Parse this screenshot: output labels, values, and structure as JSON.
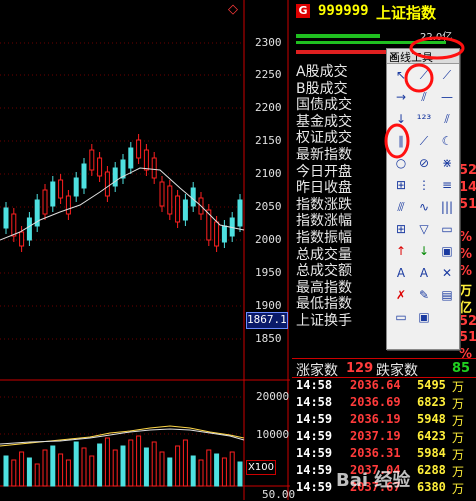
{
  "stock": {
    "badge": "G",
    "code": "999999",
    "name": "上证指数",
    "top_diamond": "◇",
    "volume_header": "22.0亿"
  },
  "price_axis": [
    "2300",
    "2250",
    "2200",
    "2150",
    "2100",
    "2050",
    "2000",
    "1950",
    "1900",
    "1850"
  ],
  "current_price": "1867.1",
  "volume_axis": [
    "20000",
    "10000"
  ],
  "volume_multiplier": "X100",
  "bottom_value": "50.00",
  "labels": [
    "A股成交",
    "B股成交",
    "国债成交",
    "基金成交",
    "权证成交",
    "最新指数",
    "今日开盘",
    "昨日收盘",
    "指数涨跌",
    "指数涨幅",
    "指数振幅",
    "总成交量",
    "总成交额",
    "最高指数",
    "最低指数",
    "上证换手"
  ],
  "right_edge_values": [
    "52",
    "14",
    "51",
    "%",
    "%",
    "%",
    "万",
    "亿",
    "52",
    "51",
    "%"
  ],
  "counts_row": {
    "label": "涨家数",
    "value": "129",
    "label2": "跌家数",
    "value2": "85"
  },
  "trades": [
    {
      "time": "14:58",
      "price": "2036.64",
      "volume": "5495",
      "unit": "万"
    },
    {
      "time": "14:58",
      "price": "2036.69",
      "volume": "6823",
      "unit": "万"
    },
    {
      "time": "14:59",
      "price": "2036.19",
      "volume": "5948",
      "unit": "万"
    },
    {
      "time": "14:59",
      "price": "2037.19",
      "volume": "6423",
      "unit": "万"
    },
    {
      "time": "14:59",
      "price": "2036.31",
      "volume": "5984",
      "unit": "万"
    },
    {
      "time": "14:59",
      "price": "2037.04",
      "volume": "6288",
      "unit": "万"
    },
    {
      "time": "14:59",
      "price": "2037.67",
      "volume": "6380",
      "unit": "万"
    }
  ],
  "toolbox": {
    "title": "画线工具",
    "close": "×"
  },
  "watermark": "Bai 经验",
  "colors": {
    "price_text": "#ff3b3b",
    "volume_text": "#ffef3a",
    "up_candle": "#ff2020",
    "down_candle": "#4ee0e0"
  }
}
